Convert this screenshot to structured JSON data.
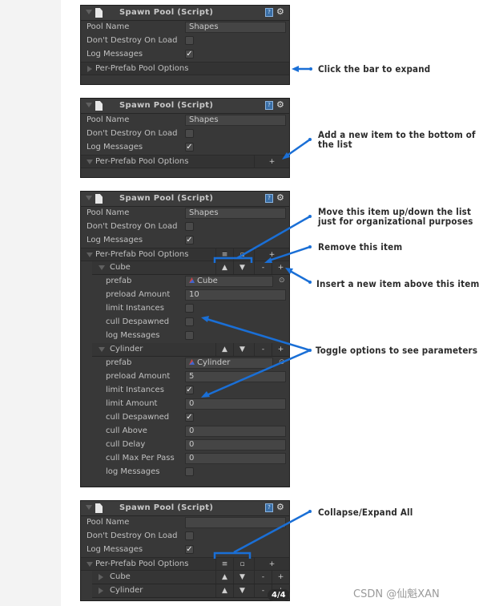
{
  "component": {
    "title": "Spawn Pool (Script)",
    "pool_name_label": "Pool Name",
    "dont_destroy_label": "Don't Destroy On Load",
    "log_messages_label": "Log Messages",
    "per_prefab_label": "Per-Prefab Pool Options"
  },
  "panels": [
    {
      "pool_name": "Shapes",
      "dont_destroy": false,
      "log_messages": true,
      "expanded": false
    },
    {
      "pool_name": "Shapes",
      "dont_destroy": false,
      "log_messages": true,
      "expanded": true,
      "add_button": "+"
    },
    {
      "pool_name": "Shapes",
      "dont_destroy": false,
      "log_messages": true,
      "expanded": true,
      "toolbar": {
        "collapse_all": "≡",
        "expand_all": "▫",
        "add": "+"
      },
      "items": [
        {
          "name": "Cube",
          "expanded": true,
          "fields": [
            {
              "label": "prefab",
              "type": "object",
              "value": "Cube"
            },
            {
              "label": "preload Amount",
              "type": "text",
              "value": "10"
            },
            {
              "label": "limit Instances",
              "type": "check",
              "value": false
            },
            {
              "label": "cull Despawned",
              "type": "check",
              "value": false
            },
            {
              "label": "log Messages",
              "type": "check",
              "value": false
            }
          ]
        },
        {
          "name": "Cylinder",
          "expanded": true,
          "fields": [
            {
              "label": "prefab",
              "type": "object",
              "value": "Cylinder"
            },
            {
              "label": "preload Amount",
              "type": "text",
              "value": "5"
            },
            {
              "label": "limit Instances",
              "type": "check",
              "value": true
            },
            {
              "label": "limit Amount",
              "type": "text",
              "value": "0"
            },
            {
              "label": "cull Despawned",
              "type": "check",
              "value": true
            },
            {
              "label": "cull Above",
              "type": "text",
              "value": "0"
            },
            {
              "label": "cull Delay",
              "type": "text",
              "value": "0"
            },
            {
              "label": "cull Max Per Pass",
              "type": "text",
              "value": "0"
            },
            {
              "label": "log Messages",
              "type": "check",
              "value": false
            }
          ]
        }
      ]
    },
    {
      "pool_name": "",
      "dont_destroy": false,
      "log_messages": true,
      "expanded": true,
      "toolbar": {
        "collapse_all": "≡",
        "expand_all": "▫",
        "add": "+"
      },
      "items": [
        {
          "name": "Cube",
          "expanded": false
        },
        {
          "name": "Cylinder",
          "expanded": false
        }
      ]
    }
  ],
  "item_buttons": {
    "up": "▲",
    "down": "▼",
    "remove": "-",
    "insert": "+"
  },
  "annotations": {
    "click_bar": "Click the bar to expand",
    "add_item": "Add a new item to the bottom of the list",
    "move_item": "Move this item up/down the list just for organizational purposes",
    "remove_item": "Remove this item",
    "insert_item": "Insert a new item above this item",
    "toggle_options": "Toggle options to see parameters",
    "collapse_expand": "Collapse/Expand All"
  },
  "page_counter": "4/4",
  "watermark": "CSDN @仙魁XAN",
  "colors": {
    "arrow": "#1a6fd6",
    "panel_bg": "#383838"
  }
}
